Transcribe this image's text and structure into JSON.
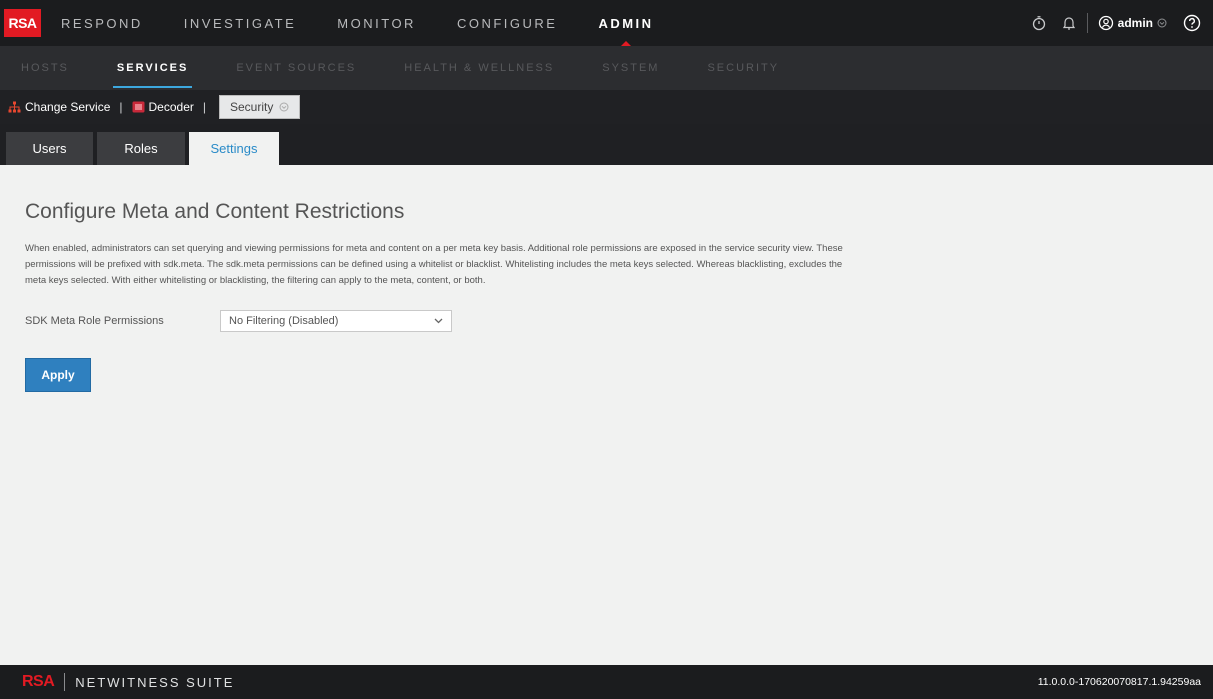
{
  "brand": {
    "logo_text": "RSA",
    "accent": "#e21a23"
  },
  "main_nav": [
    {
      "label": "RESPOND"
    },
    {
      "label": "INVESTIGATE"
    },
    {
      "label": "MONITOR"
    },
    {
      "label": "CONFIGURE"
    },
    {
      "label": "ADMIN",
      "active": true
    }
  ],
  "user_menu": {
    "username": "admin"
  },
  "sub_nav": [
    {
      "label": "HOSTS"
    },
    {
      "label": "SERVICES",
      "active": true
    },
    {
      "label": "EVENT SOURCES"
    },
    {
      "label": "HEALTH & WELLNESS"
    },
    {
      "label": "SYSTEM"
    },
    {
      "label": "SECURITY"
    }
  ],
  "service_bar": {
    "change_service_label": "Change Service",
    "service_label": "Decoder",
    "view_label": "Security",
    "separator": "|"
  },
  "tabs": [
    {
      "label": "Users"
    },
    {
      "label": "Roles"
    },
    {
      "label": "Settings",
      "active": true
    }
  ],
  "main": {
    "title": "Configure Meta and Content Restrictions",
    "description": "When enabled, administrators can set querying and viewing permissions for meta and content on a per meta key basis. Additional role permissions are exposed in the service security view. These permissions will be prefixed with sdk.meta. The sdk.meta permissions can be defined using a whitelist or blacklist. Whitelisting includes the meta keys selected. Whereas blacklisting, excludes the meta keys selected. With either whitelisting or blacklisting, the filtering can apply to the meta, content, or both.",
    "permission_label": "SDK Meta Role Permissions",
    "permission_value": "No Filtering (Disabled)",
    "apply_label": "Apply"
  },
  "footer": {
    "logo_text": "RSA",
    "suite_name": "NETWITNESS SUITE",
    "version": "11.0.0.0-170620070817.1.94259aa"
  }
}
